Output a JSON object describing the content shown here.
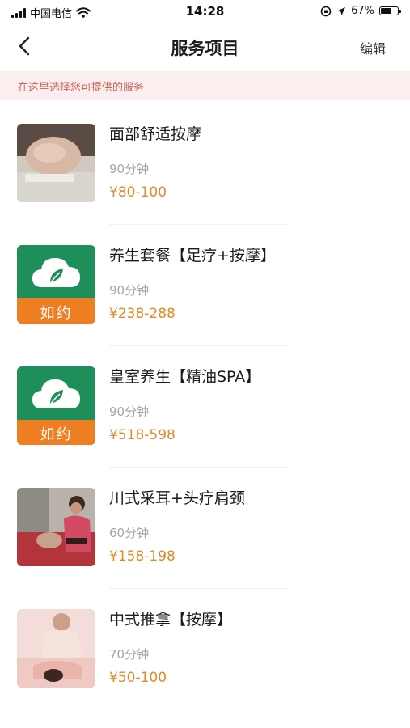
{
  "status_bar": {
    "carrier": "中国电信",
    "time": "14:28",
    "battery": "67%",
    "battery_level": 0.67
  },
  "nav": {
    "title": "服务项目",
    "edit_label": "编辑"
  },
  "hint": {
    "text": "在这里选择您可提供的服务"
  },
  "logo": {
    "band_text": "如约",
    "brand_green": "#1e8f5b",
    "brand_orange": "#ef7d21"
  },
  "services": [
    {
      "name": "面部舒适按摩",
      "duration": "90分钟",
      "price": "¥80-100"
    },
    {
      "name": "养生套餐【足疗+按摩】",
      "duration": "90分钟",
      "price": "¥238-288"
    },
    {
      "name": "皇室养生【精油SPA】",
      "duration": "90分钟",
      "price": "¥518-598"
    },
    {
      "name": "川式采耳+头疗肩颈",
      "duration": "60分钟",
      "price": "¥158-198"
    },
    {
      "name": "中式推拿【按摩】",
      "duration": "70分钟",
      "price": "¥50-100"
    }
  ],
  "colors": {
    "price": "#e08a2a",
    "hint_bg": "#fbeeee",
    "hint_text": "#d0625a"
  }
}
